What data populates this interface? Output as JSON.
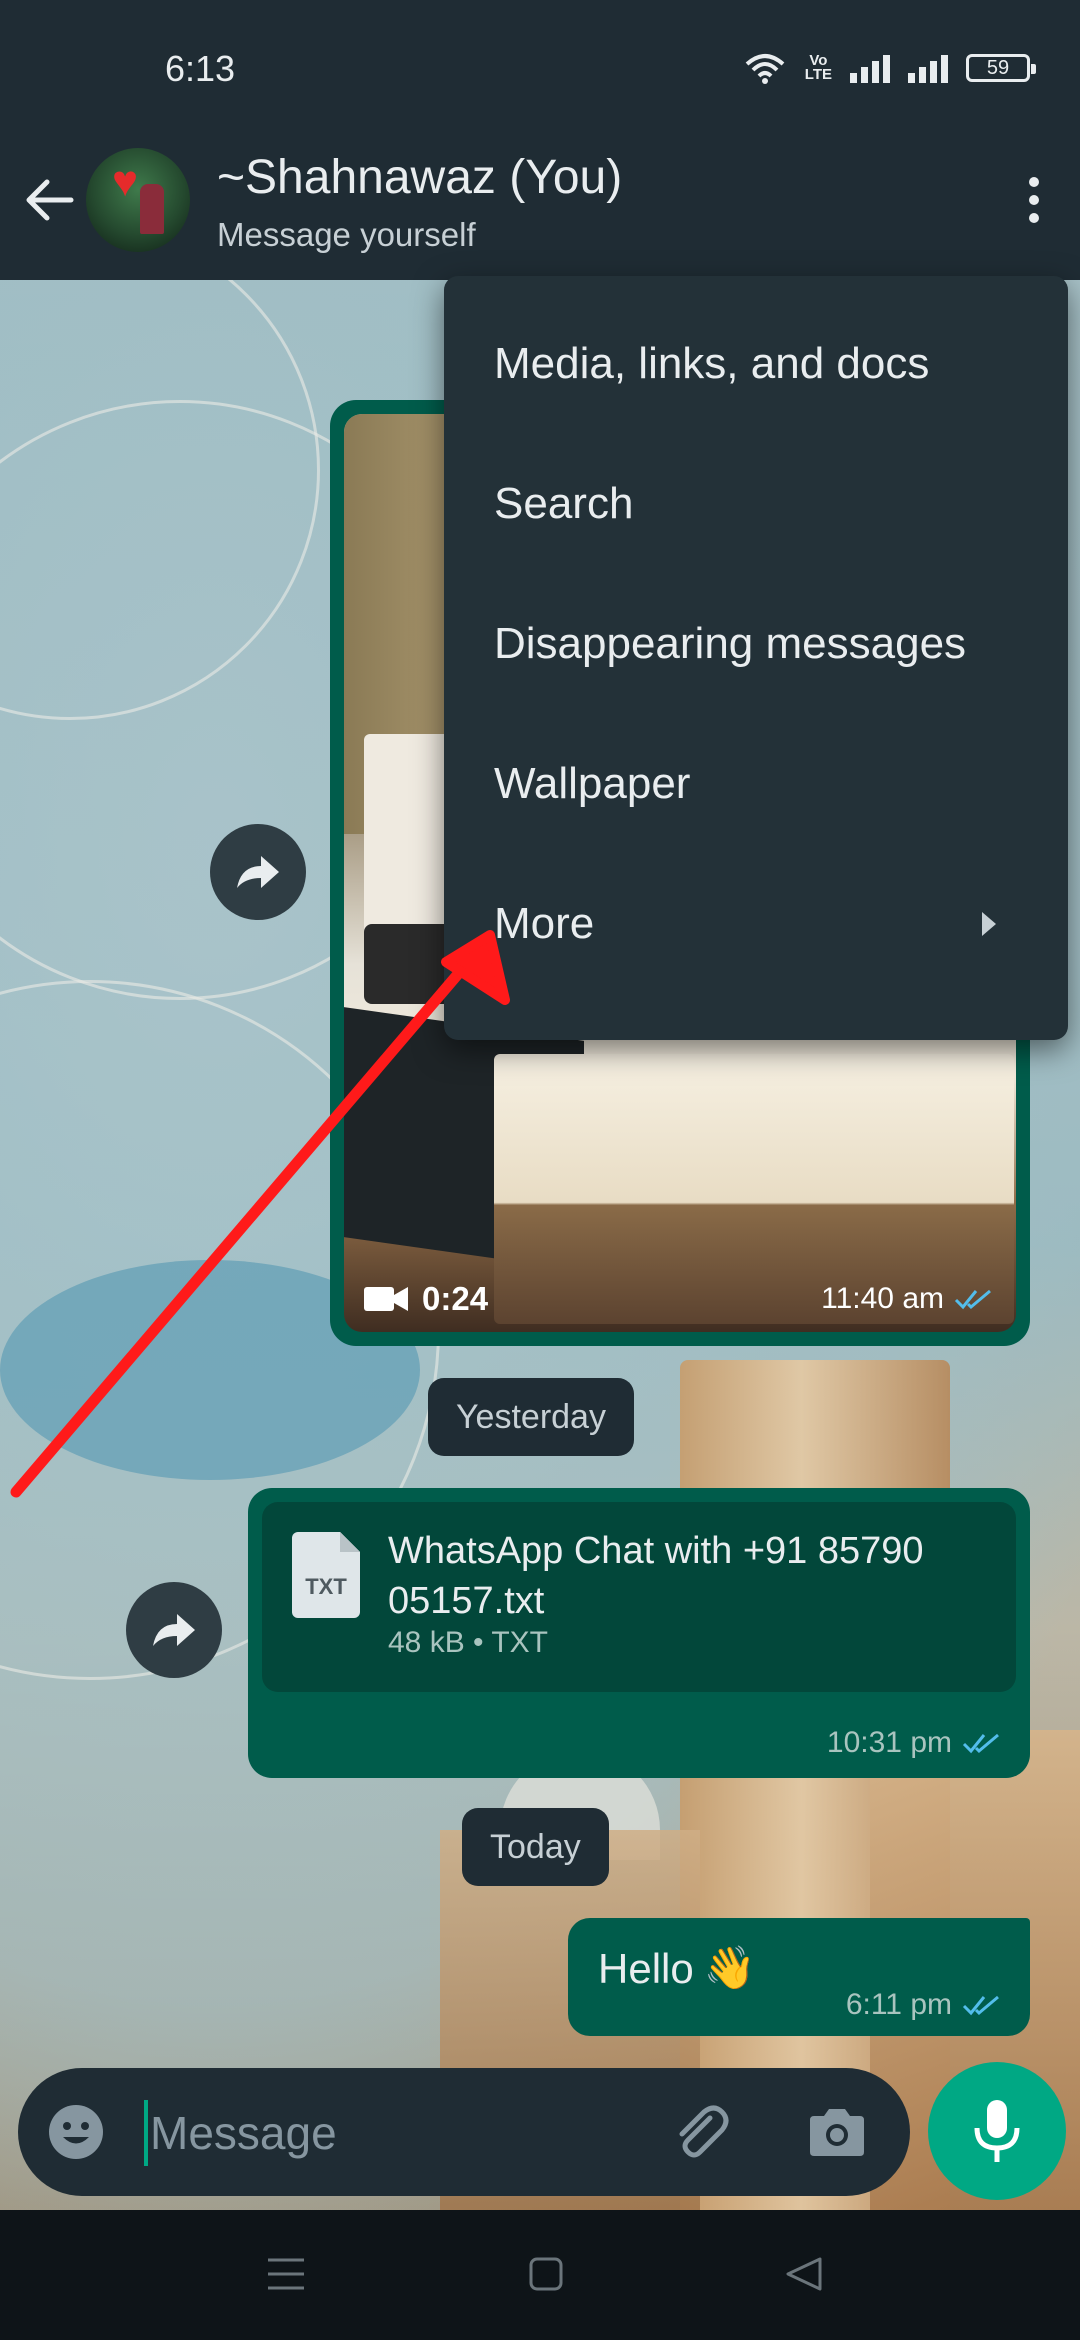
{
  "status_bar": {
    "time": "6:13",
    "network_label_top": "Vo",
    "network_label_bottom": "LTE",
    "battery": "59"
  },
  "header": {
    "contact_name": "~Shahnawaz (You)",
    "subtitle": "Message yourself",
    "icons": [
      "back-arrow-icon",
      "more-options-icon"
    ]
  },
  "messages": {
    "video": {
      "duration": "0:24",
      "time": "11:40 am",
      "status": "read"
    },
    "date_yesterday": "Yesterday",
    "document": {
      "icon_label": "TXT",
      "file_name": "WhatsApp Chat with +91 85790 05157.txt",
      "info": "48 kB • TXT",
      "time": "10:31 pm",
      "status": "read"
    },
    "date_today": "Today",
    "text_message": {
      "text": "Hello",
      "emoji": "👋",
      "time": "6:11 pm",
      "status": "read"
    }
  },
  "input": {
    "placeholder": "Message",
    "icons": [
      "emoji-icon",
      "attach-icon",
      "camera-icon",
      "mic-icon"
    ]
  },
  "overflow_menu": {
    "items": [
      {
        "label": "Media, links, and docs"
      },
      {
        "label": "Search"
      },
      {
        "label": "Disappearing messages"
      },
      {
        "label": "Wallpaper"
      },
      {
        "label": "More",
        "has_submenu": true
      }
    ]
  },
  "colors": {
    "app_bar": "#1f2c34",
    "outgoing_bubble": "#005c4b",
    "accent": "#00a884",
    "read_ticks": "#53bdeb",
    "annotation_arrow": "#ff1a1a"
  }
}
